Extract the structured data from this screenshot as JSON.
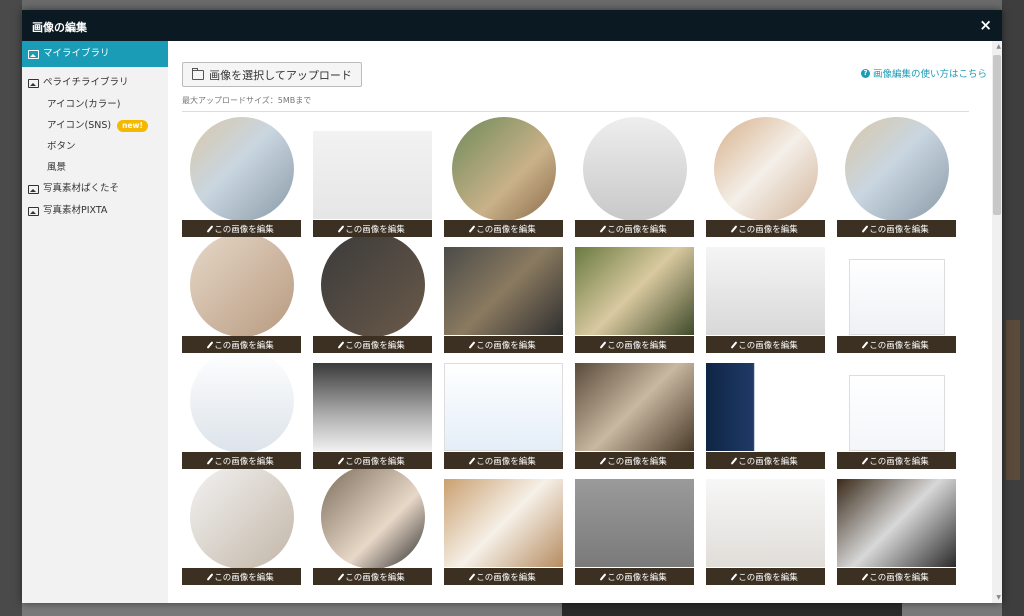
{
  "modal": {
    "title": "画像の編集",
    "close_glyph": "×"
  },
  "sidebar": {
    "items": [
      {
        "label": "マイライブラリ",
        "active": true
      },
      {
        "label": "ペライチライブラリ",
        "active": false
      }
    ],
    "subitems": [
      {
        "label": "アイコン(カラー)"
      },
      {
        "label": "アイコン(SNS)",
        "badge": "new!"
      },
      {
        "label": "ボタン"
      },
      {
        "label": "風景"
      }
    ],
    "bottom_items": [
      {
        "label": "写真素材ぱくたそ"
      },
      {
        "label": "写真素材PIXTA"
      }
    ]
  },
  "main": {
    "upload_button": "画像を選択してアップロード",
    "upload_note": "最大アップロードサイズ：5MBまで",
    "help_link": "画像編集の使い方はこちら",
    "edit_label": "この画像を編集"
  },
  "colors": {
    "header_bg": "#0b1a22",
    "accent": "#1a9cb7",
    "edit_bar": "#3c3023",
    "badge": "#f5b800"
  },
  "tiles": [
    {
      "name": "map-desk",
      "shape": "circle",
      "style": "t-map"
    },
    {
      "name": "white-laptop",
      "shape": "full",
      "style": "t-laptop-w"
    },
    {
      "name": "coffee-plant",
      "shape": "circle",
      "style": "t-plant"
    },
    {
      "name": "keyboard",
      "shape": "circle",
      "style": "t-keyboard"
    },
    {
      "name": "chart-paper",
      "shape": "circle",
      "style": "t-chart"
    },
    {
      "name": "map-desk-2",
      "shape": "circle",
      "style": "t-map"
    },
    {
      "name": "typing",
      "shape": "circle",
      "style": "t-typing"
    },
    {
      "name": "team-laptops",
      "shape": "circle",
      "style": "t-team-dark"
    },
    {
      "name": "meeting",
      "shape": "full",
      "style": "t-meeting"
    },
    {
      "name": "hands-table",
      "shape": "full",
      "style": "t-hands"
    },
    {
      "name": "desk-laptop",
      "shape": "full",
      "style": "t-desk"
    },
    {
      "name": "webpage-screenshot",
      "shape": "rect",
      "style": "t-webpage"
    },
    {
      "name": "man-sitting",
      "shape": "circle",
      "style": "t-man"
    },
    {
      "name": "online-business-lab",
      "shape": "full",
      "style": "t-site-dark"
    },
    {
      "name": "site-blue",
      "shape": "full",
      "style": "t-site-blue"
    },
    {
      "name": "office-team",
      "shape": "full",
      "style": "t-office"
    },
    {
      "name": "app-dark",
      "shape": "full",
      "style": "t-app-dark"
    },
    {
      "name": "site-text",
      "shape": "rect",
      "style": "t-site-text"
    },
    {
      "name": "man-glasses",
      "shape": "circle",
      "style": "t-glasses"
    },
    {
      "name": "woman",
      "shape": "circle",
      "style": "t-woman"
    },
    {
      "name": "report-desk",
      "shape": "full",
      "style": "t-report"
    },
    {
      "name": "graph-gray",
      "shape": "full",
      "style": "t-graph-gray"
    },
    {
      "name": "monitor-desk",
      "shape": "full",
      "style": "t-monitor"
    },
    {
      "name": "finance",
      "shape": "full",
      "style": "t-finance"
    }
  ]
}
